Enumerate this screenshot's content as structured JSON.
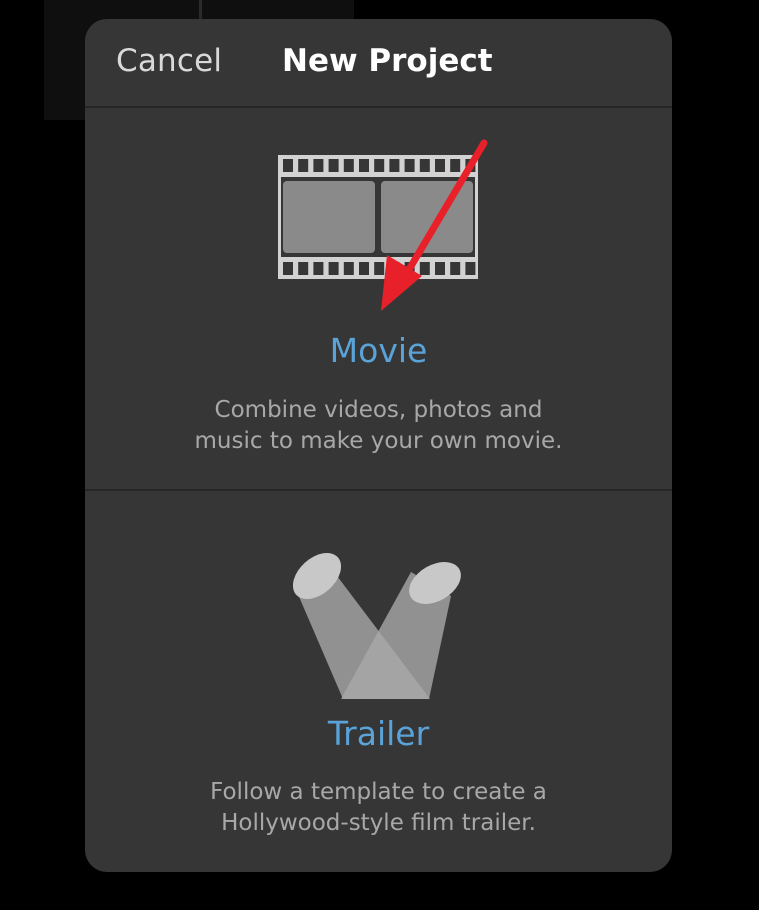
{
  "header": {
    "cancel_label": "Cancel",
    "title": "New Project"
  },
  "options": [
    {
      "label": "Movie",
      "description_line1": "Combine videos, photos and",
      "description_line2": "music to make your own movie.",
      "icon": "film-strip-icon"
    },
    {
      "label": "Trailer",
      "description_line1": "Follow a template to create a",
      "description_line2": "Hollywood-style film trailer.",
      "icon": "spotlights-icon"
    }
  ],
  "colors": {
    "accent": "#5aa3d8",
    "sheet_background": "#363636",
    "annotation_arrow": "#e8202a"
  }
}
